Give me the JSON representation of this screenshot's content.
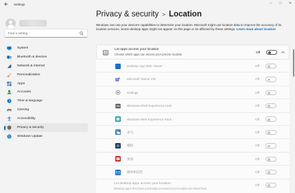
{
  "window": {
    "title": "Settings",
    "controls": {
      "minimize": "─",
      "maximize": "□",
      "close": "✕"
    }
  },
  "search": {
    "placeholder": "Find a setting"
  },
  "sidebar": {
    "items": [
      {
        "label": "System",
        "icon": "system-icon",
        "color": "#0078d4"
      },
      {
        "label": "Bluetooth & devices",
        "icon": "bluetooth-icon",
        "color": "#0063b1"
      },
      {
        "label": "Network & internet",
        "icon": "network-icon",
        "color": "#2b579a"
      },
      {
        "label": "Personalization",
        "icon": "brush-icon",
        "color": "#e8a33d"
      },
      {
        "label": "Apps",
        "icon": "apps-icon",
        "color": "#4a6eb3"
      },
      {
        "label": "Accounts",
        "icon": "accounts-icon",
        "color": "#2fa24a"
      },
      {
        "label": "Time & language",
        "icon": "time-language-icon",
        "color": "#0078d4"
      },
      {
        "label": "Gaming",
        "icon": "gaming-icon",
        "color": "#7a7a7a"
      },
      {
        "label": "Accessibility",
        "icon": "accessibility-icon",
        "color": "#1a73c8"
      },
      {
        "label": "Privacy & security",
        "icon": "shield-icon",
        "color": "#6b6b6b",
        "active": true
      },
      {
        "label": "Windows Update",
        "icon": "update-icon",
        "color": "#0067c0"
      }
    ]
  },
  "breadcrumb": {
    "parent": "Privacy & security",
    "separator": ">",
    "current": "Location"
  },
  "description": {
    "text": "Windows can use your device's capabilities to determine your location. Microsoft might use location data to improve the accuracy of its location services. Some desktop apps might not appear on this page or be affected by these settings.",
    "link": "Learn more about location"
  },
  "apps_access": {
    "title": "Let apps access your location",
    "subtitle": "Choose which apps can access your precise location",
    "state": "Off"
  },
  "apps": [
    {
      "name": "Desktop App Web Viewer",
      "state": "Off",
      "icon": "web-viewer-icon",
      "color": "#1a73c8"
    },
    {
      "name": "Microsoft Teams VDI",
      "state": "Off",
      "icon": "teams-icon",
      "color": "#5b5fc7"
    },
    {
      "name": "Settings",
      "state": "Off",
      "icon": "settings-gear-icon",
      "color": "#7a7a7a"
    },
    {
      "name": "Windows Shell Experience Host",
      "state": "Off",
      "icon": "shell-host-icon",
      "color": "#3a3a3a"
    },
    {
      "name": "Windows Web Experience Pack",
      "state": "Off",
      "icon": "web-experience-icon",
      "color": "#1aa0a0"
    },
    {
      "name": "天气",
      "state": "Off",
      "icon": "weather-icon",
      "color": "#f2a93b"
    },
    {
      "name": "相机",
      "state": "Off",
      "icon": "camera-icon",
      "color": "#2a3b5a"
    },
    {
      "name": "资讯",
      "state": "Off",
      "icon": "news-icon",
      "color": "#c62828"
    },
    {
      "name": "邮件和日历",
      "state": "Off",
      "icon": "mail-calendar-icon",
      "color": "#1565c0"
    }
  ],
  "desktop_access": {
    "title": "Let desktop apps access your location",
    "subtitle": "Desktop apps that have previously accessed your location are listed here",
    "state": "Off"
  }
}
